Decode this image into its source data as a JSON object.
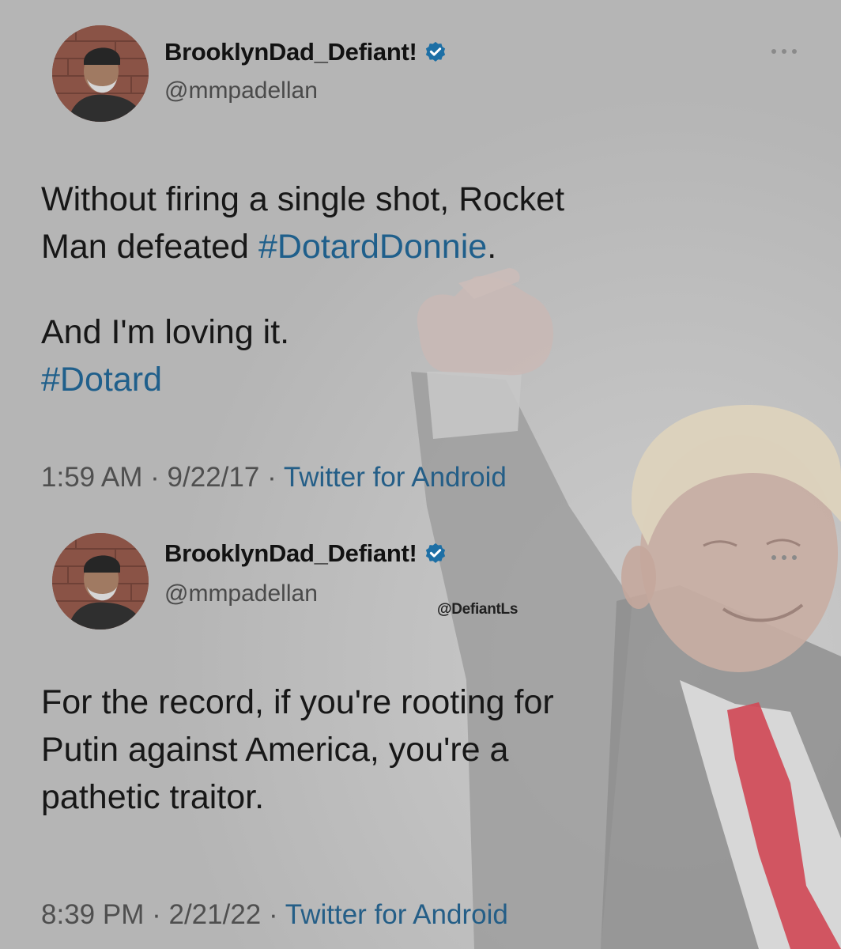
{
  "tweets": [
    {
      "display_name": "BrooklynDad_Defiant!",
      "handle": "@mmpadellan",
      "paragraphs": [
        [
          [
            {
              "text": "Without firing a single shot, Rocket",
              "hashtag": false
            }
          ],
          [
            {
              "text": "Man defeated ",
              "hashtag": false
            },
            {
              "text": "#DotardDonnie",
              "hashtag": true
            },
            {
              "text": ".",
              "hashtag": false
            }
          ]
        ],
        [
          [
            {
              "text": "And I'm loving it.",
              "hashtag": false
            }
          ],
          [
            {
              "text": "#Dotard",
              "hashtag": true
            }
          ]
        ]
      ],
      "time": "1:59 AM",
      "date": "9/22/17",
      "source": "Twitter for Android",
      "separator": "·"
    },
    {
      "display_name": "BrooklynDad_Defiant!",
      "handle": "@mmpadellan",
      "paragraphs": [
        [
          [
            {
              "text": "For the record, if you're rooting for",
              "hashtag": false
            }
          ],
          [
            {
              "text": "Putin against America, you're a",
              "hashtag": false
            }
          ],
          [
            {
              "text": "pathetic traitor.",
              "hashtag": false
            }
          ]
        ]
      ],
      "time": "8:39 PM",
      "date": "2/21/22",
      "source": "Twitter for Android",
      "separator": "·"
    }
  ],
  "watermark": "@DefiantLs",
  "icons": {
    "verified": "verified-badge-icon",
    "more": "more-options-icon"
  },
  "colors": {
    "background": "#b9b9b9",
    "hashtag": "#1f5f8b",
    "source_link": "#245e87",
    "verified": "#1d6fa5",
    "tie": "#d04a57"
  }
}
